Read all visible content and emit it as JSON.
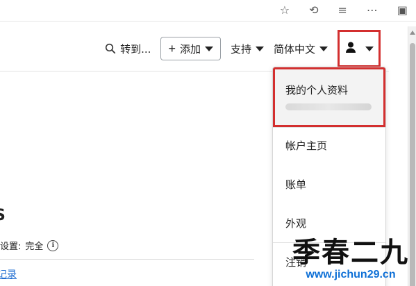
{
  "browser": {
    "icons": [
      "star-icon",
      "extensions-icon",
      "reading-list-icon",
      "more-icon",
      "sidebar-icon"
    ],
    "icon_glyphs": [
      "☆",
      "⟲",
      "≡",
      "⋯",
      "▣"
    ]
  },
  "header": {
    "goto_label": "转到...",
    "add_label": "添加",
    "support_label": "支持",
    "language_label": "简体中文"
  },
  "content": {
    "heading_fragment": "S",
    "setting_label": "设置:",
    "setting_value": "完全",
    "link_fragment": "记录"
  },
  "dropdown": {
    "items": [
      {
        "label": "我的个人资料"
      },
      {
        "label": "帐户主页"
      },
      {
        "label": "账单"
      },
      {
        "label": "外观"
      },
      {
        "label": "注销"
      }
    ]
  },
  "watermark": {
    "cn": "季春二九",
    "url": "www.jichun29.cn"
  },
  "colors": {
    "highlight_red": "#d32f2f",
    "link_blue": "#1f6dd1"
  }
}
